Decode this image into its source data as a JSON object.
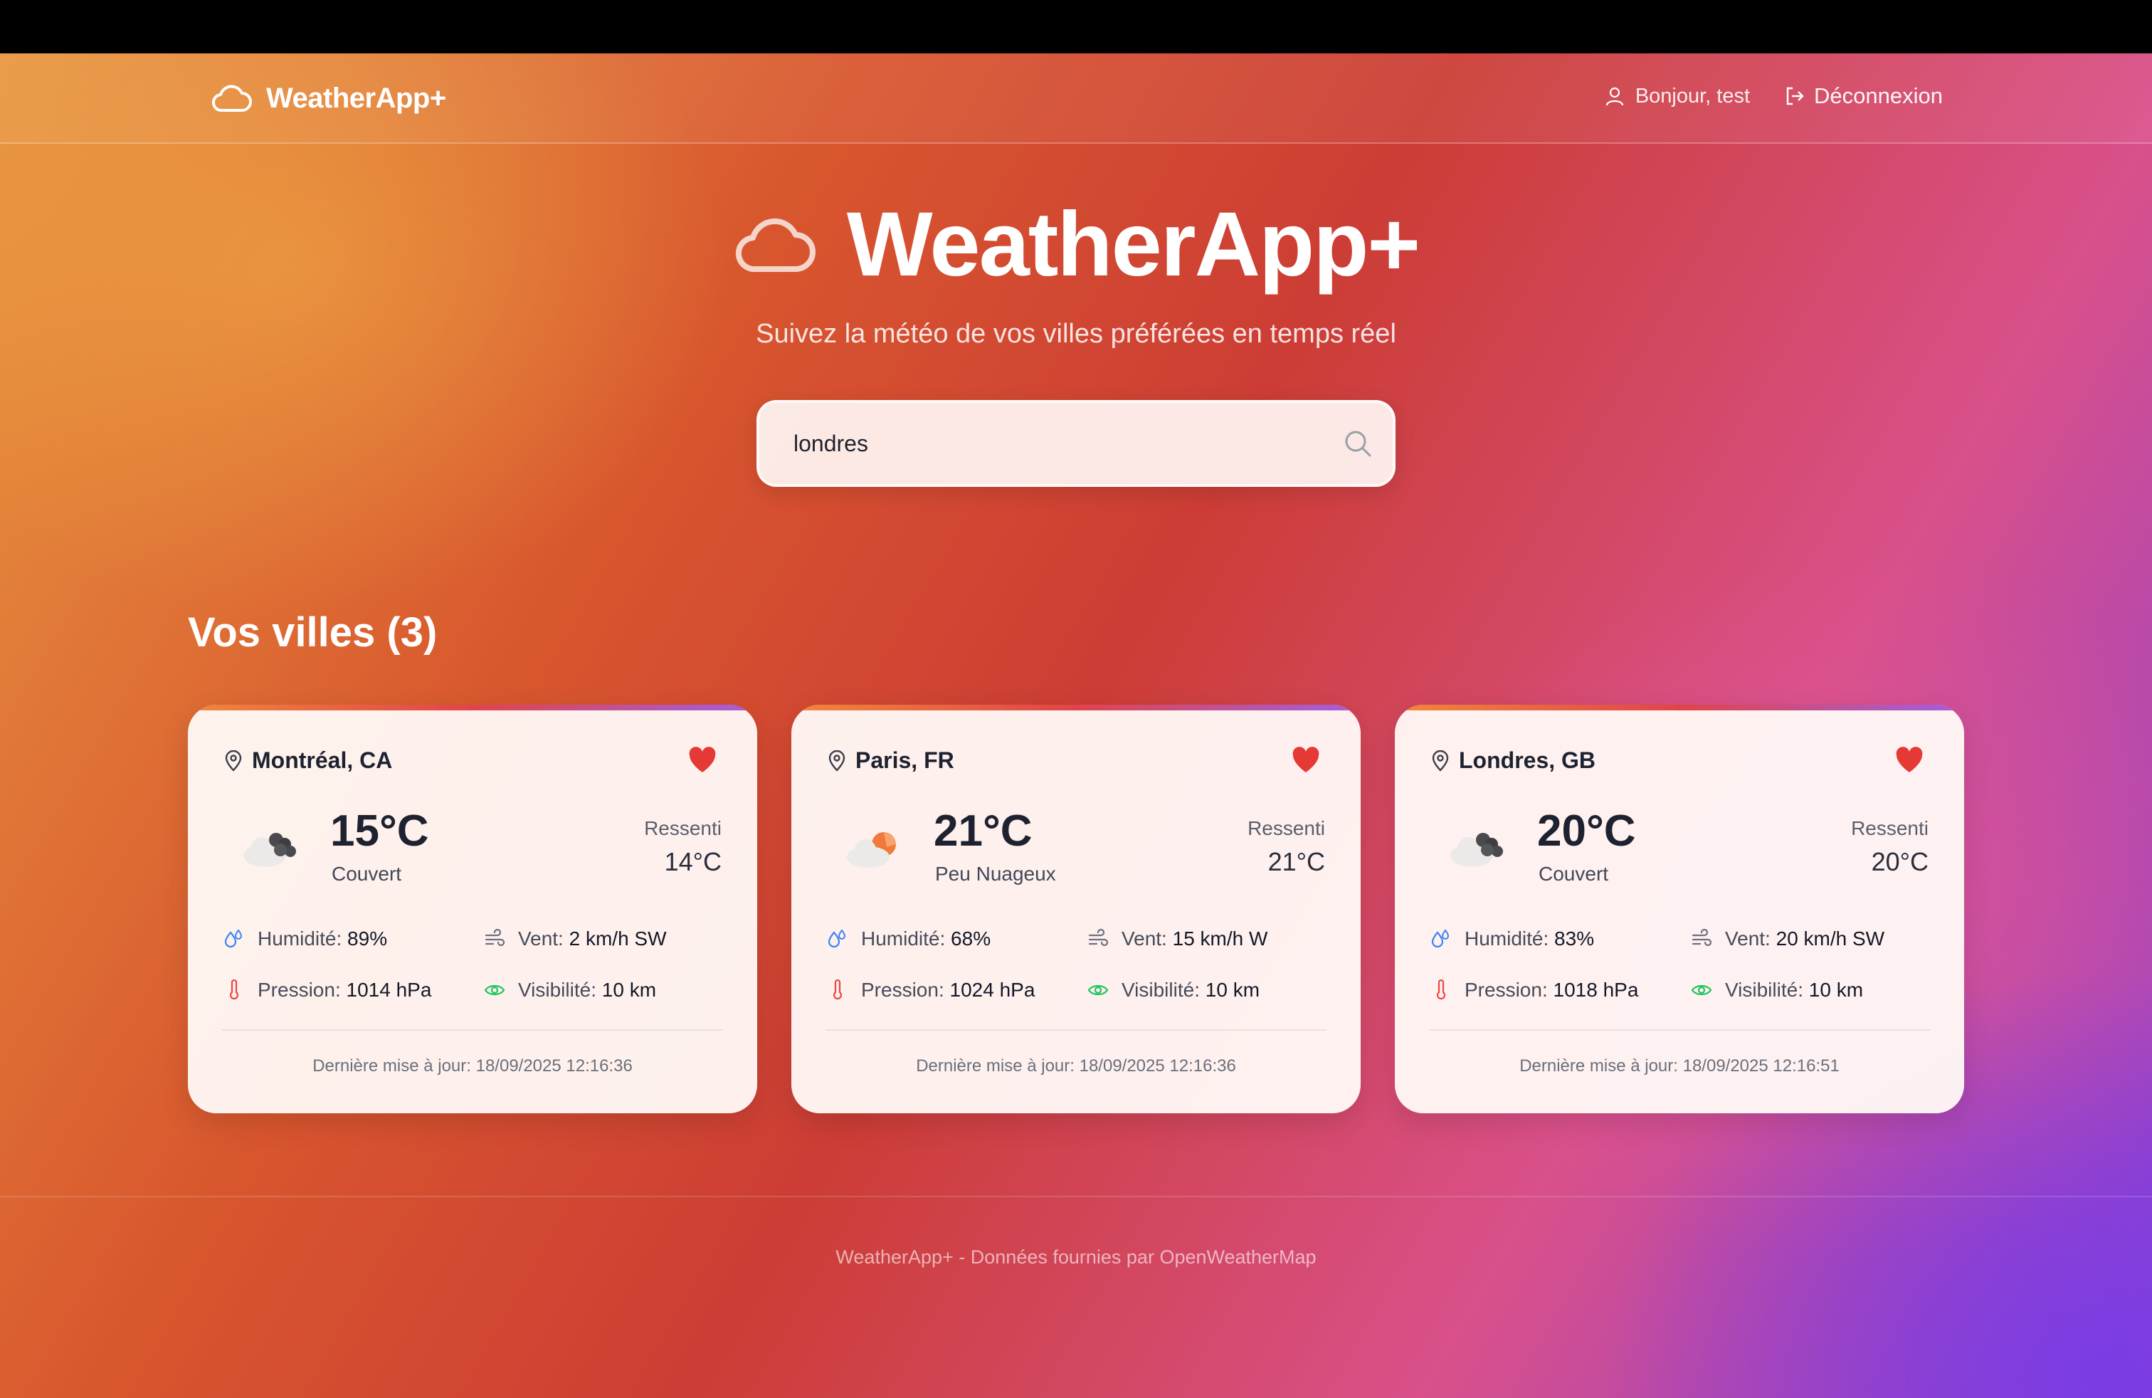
{
  "header": {
    "brand": "WeatherApp+",
    "greeting": "Bonjour, test",
    "logout_label": "Déconnexion"
  },
  "hero": {
    "title": "WeatherApp+",
    "subtitle": "Suivez la météo de vos villes préférées en temps réel"
  },
  "search": {
    "value": "londres"
  },
  "section": {
    "title": "Vos villes (3)"
  },
  "cards": [
    {
      "city": "Montréal, CA",
      "icon": "overcast-cloud-icon",
      "temp": "15°C",
      "desc": "Couvert",
      "feel_label": "Ressenti",
      "feel": "14°C",
      "humidity_label": "Humidité:",
      "humidity": "89%",
      "wind_label": "Vent:",
      "wind": "2 km/h SW",
      "pressure_label": "Pression:",
      "pressure": "1014 hPa",
      "visibility_label": "Visibilité:",
      "visibility": "10 km",
      "updated": "Dernière mise à jour: 18/09/2025 12:16:36"
    },
    {
      "city": "Paris, FR",
      "icon": "partly-cloudy-icon",
      "temp": "21°C",
      "desc": "Peu Nuageux",
      "feel_label": "Ressenti",
      "feel": "21°C",
      "humidity_label": "Humidité:",
      "humidity": "68%",
      "wind_label": "Vent:",
      "wind": "15 km/h W",
      "pressure_label": "Pression:",
      "pressure": "1024 hPa",
      "visibility_label": "Visibilité:",
      "visibility": "10 km",
      "updated": "Dernière mise à jour: 18/09/2025 12:16:36"
    },
    {
      "city": "Londres, GB",
      "icon": "overcast-cloud-icon",
      "temp": "20°C",
      "desc": "Couvert",
      "feel_label": "Ressenti",
      "feel": "20°C",
      "humidity_label": "Humidité:",
      "humidity": "83%",
      "wind_label": "Vent:",
      "wind": "20 km/h SW",
      "pressure_label": "Pression:",
      "pressure": "1018 hPa",
      "visibility_label": "Visibilité:",
      "visibility": "10 km",
      "updated": "Dernière mise à jour: 18/09/2025 12:16:51"
    }
  ],
  "footer": {
    "text": "WeatherApp+ - Données fournies par OpenWeatherMap"
  },
  "colors": {
    "accent_red": "#e53935",
    "humidity_blue": "#3b82f6",
    "pressure_red": "#ef4444",
    "visibility_green": "#22c55e"
  }
}
